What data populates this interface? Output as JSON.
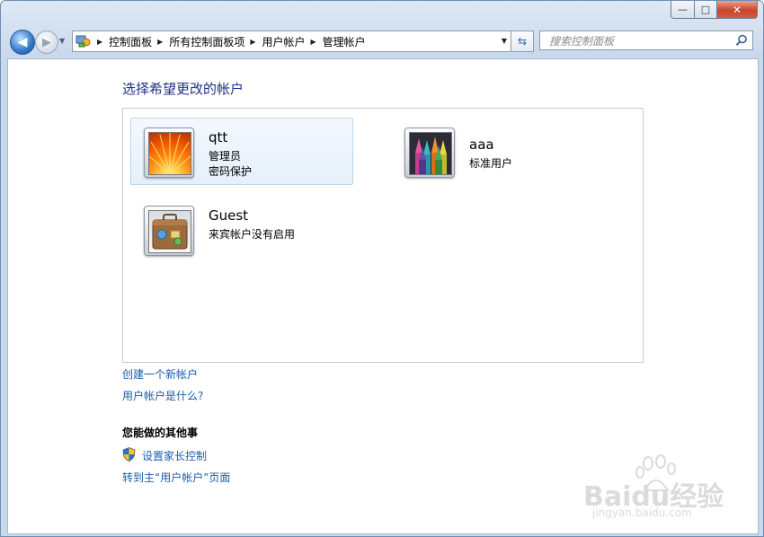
{
  "window": {
    "caption": {
      "minimize": "—",
      "maximize": "□",
      "close": "✕"
    }
  },
  "navbar": {
    "breadcrumbs": [
      "控制面板",
      "所有控制面板项",
      "用户帐户",
      "管理帐户"
    ],
    "search_placeholder": "搜索控制面板"
  },
  "main": {
    "heading": "选择希望更改的帐户",
    "accounts": [
      {
        "name": "qtt",
        "lines": [
          "管理员",
          "密码保护"
        ],
        "picture": "orange-flower",
        "selected": true
      },
      {
        "name": "aaa",
        "lines": [
          "标准用户"
        ],
        "picture": "crayons",
        "selected": false
      },
      {
        "name": "Guest",
        "lines": [
          "来宾帐户没有启用"
        ],
        "picture": "suitcase",
        "selected": false
      }
    ],
    "links": {
      "create_account": "创建一个新帐户",
      "what_is": "用户帐户是什么?"
    },
    "other": {
      "title": "您能做的其他事",
      "parental": "设置家长控制",
      "goto_main": "转到主“用户帐户”页面"
    }
  },
  "watermark": {
    "logo": "Baidu经验",
    "url": "jingyan.baidu.com"
  },
  "colors": {
    "link": "#1b5ca8",
    "heading": "#1e3287",
    "selection": "#e5f0fb"
  }
}
